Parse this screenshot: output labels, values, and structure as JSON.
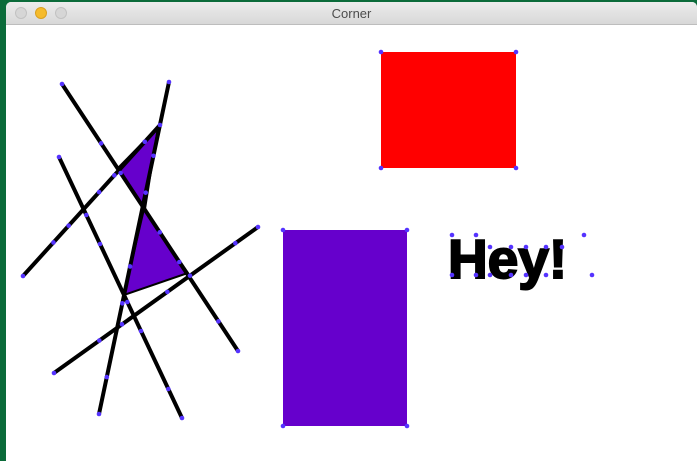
{
  "window": {
    "title": "Corner"
  },
  "colors": {
    "purple": "#6600cc",
    "red": "#ff0000",
    "marker": "#5533ff",
    "stroke": "#000000",
    "min_button": "#f5bb2c"
  },
  "canvas": {
    "text": "Hey!"
  }
}
